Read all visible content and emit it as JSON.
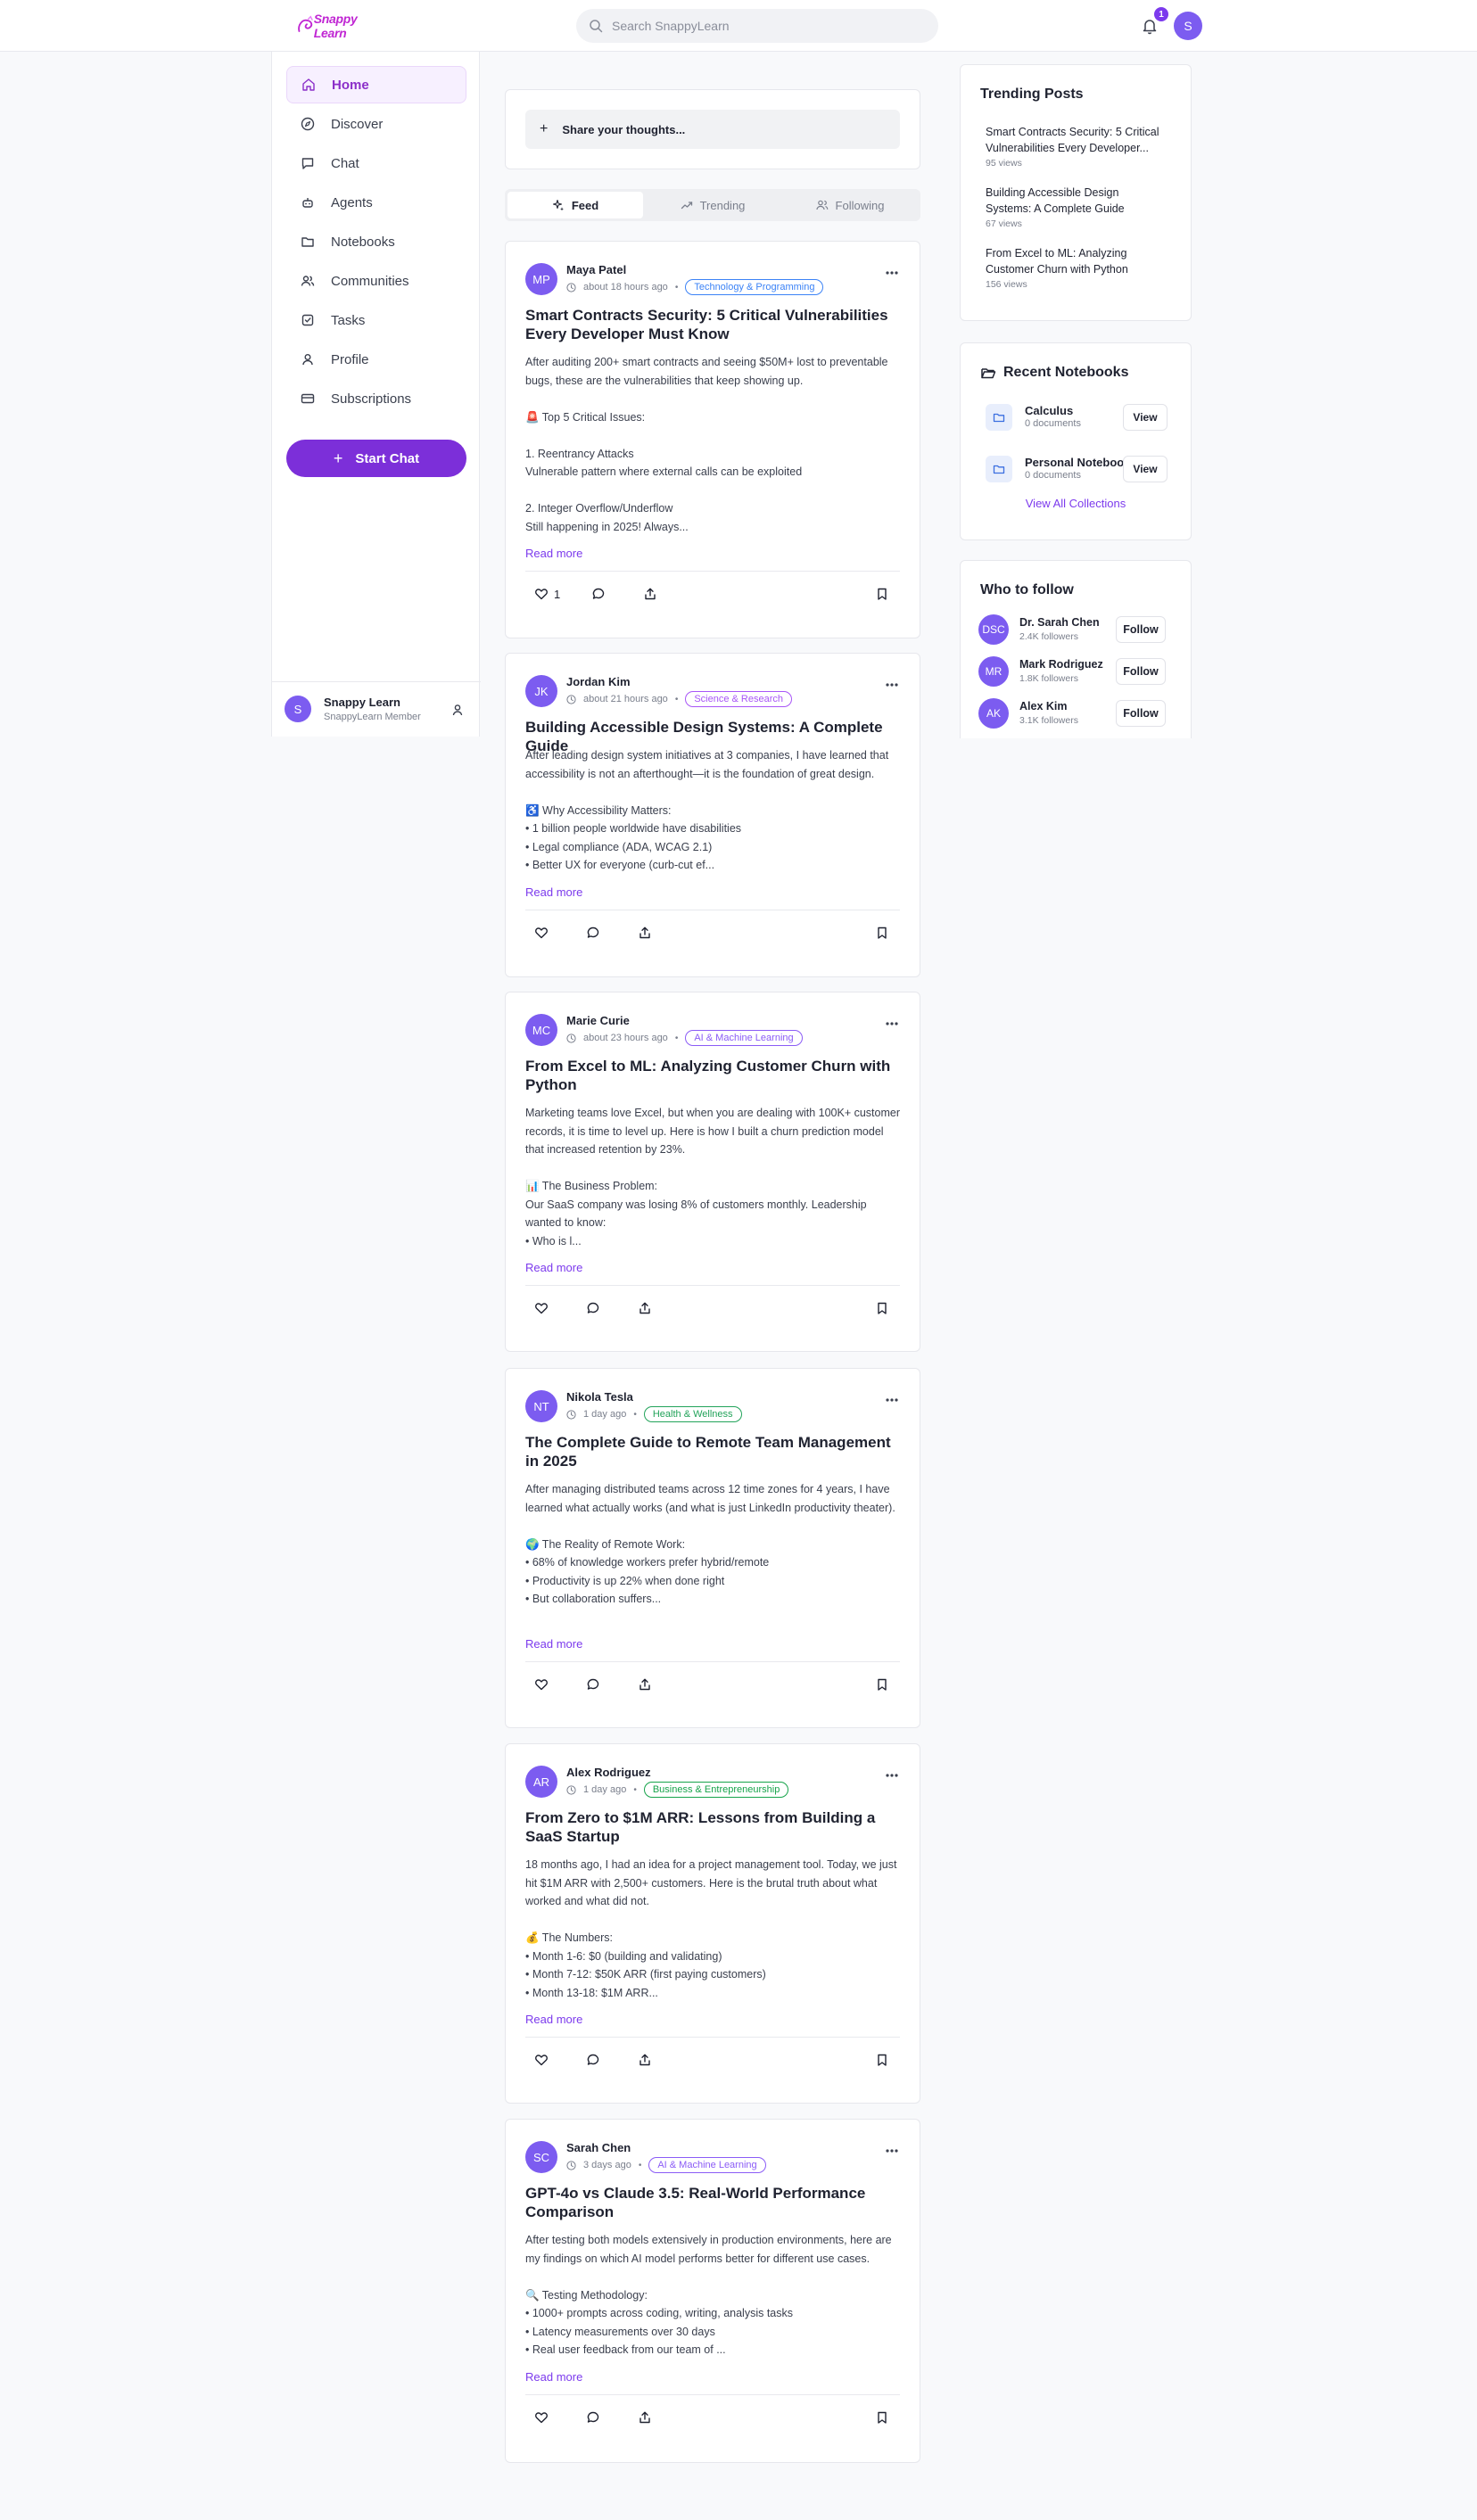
{
  "header": {
    "logo_text": "Snappy Learn",
    "search_placeholder": "Search SnappyLearn",
    "notification_count": "1",
    "user_initial": "S"
  },
  "sidebar": {
    "items": [
      {
        "label": "Home",
        "icon": "home-icon"
      },
      {
        "label": "Discover",
        "icon": "compass-icon"
      },
      {
        "label": "Chat",
        "icon": "chat-icon"
      },
      {
        "label": "Agents",
        "icon": "bot-icon"
      },
      {
        "label": "Notebooks",
        "icon": "folder-icon"
      },
      {
        "label": "Communities",
        "icon": "users-icon"
      },
      {
        "label": "Tasks",
        "icon": "checkbox-icon"
      },
      {
        "label": "Profile",
        "icon": "user-icon"
      },
      {
        "label": "Subscriptions",
        "icon": "credit-card-icon"
      }
    ],
    "start_chat": "Start Chat",
    "user": {
      "initial": "S",
      "name": "Snappy Learn",
      "role": "SnappyLearn Member"
    }
  },
  "composer": {
    "placeholder": "Share your thoughts..."
  },
  "tabs": [
    {
      "label": "Feed"
    },
    {
      "label": "Trending"
    },
    {
      "label": "Following"
    }
  ],
  "posts": [
    {
      "initials": "MP",
      "author": "Maya Patel",
      "time": "about 18 hours ago",
      "tag": "Technology & Programming",
      "tag_color": "#3b82f6",
      "title": "Smart Contracts Security: 5 Critical Vulnerabilities Every Developer Must Know",
      "body": "After auditing 200+ smart contracts and seeing $50M+ lost to preventable bugs, these are the vulnerabilities that keep showing up.\n\n🚨 Top 5 Critical Issues:\n\n1. Reentrancy Attacks\nVulnerable pattern where external calls can be exploited\n\n2. Integer Overflow/Underflow\nStill happening in 2025! Always...",
      "read_more": "Read more",
      "likes": "1"
    },
    {
      "initials": "JK",
      "author": "Jordan Kim",
      "time": "about 21 hours ago",
      "tag": "Science & Research",
      "tag_color": "#a855f7",
      "title": "Building Accessible Design Systems: A Complete Guide",
      "body": "After leading design system initiatives at 3 companies, I have learned that accessibility is not an afterthought—it is the foundation of great design.\n\n♿ Why Accessibility Matters:\n• 1 billion people worldwide have disabilities\n• Legal compliance (ADA, WCAG 2.1)\n• Better UX for everyone (curb-cut ef...",
      "read_more": "Read more",
      "likes": ""
    },
    {
      "initials": "MC",
      "author": "Marie Curie",
      "time": "about 23 hours ago",
      "tag": "AI & Machine Learning",
      "tag_color": "#8b5cf6",
      "title": "From Excel to ML: Analyzing Customer Churn with Python",
      "body": "Marketing teams love Excel, but when you are dealing with 100K+ customer records, it is time to level up. Here is how I built a churn prediction model that increased retention by 23%.\n\n📊 The Business Problem:\nOur SaaS company was losing 8% of customers monthly. Leadership wanted to know:\n• Who is l...",
      "read_more": "Read more",
      "likes": ""
    },
    {
      "initials": "NT",
      "author": "Nikola Tesla",
      "time": "1 day ago",
      "tag": "Health & Wellness",
      "tag_color": "#22a35a",
      "title": "The Complete Guide to Remote Team Management in 2025",
      "body": "After managing distributed teams across 12 time zones for 4 years, I have learned what actually works (and what is just LinkedIn productivity theater).\n\n🌍 The Reality of Remote Work:\n• 68% of knowledge workers prefer hybrid/remote\n• Productivity is up 22% when done right\n• But collaboration suffers...",
      "read_more": "Read more",
      "likes": ""
    },
    {
      "initials": "AR",
      "author": "Alex Rodriguez",
      "time": "1 day ago",
      "tag": "Business & Entrepreneurship",
      "tag_color": "#16a34a",
      "title": "From Zero to $1M ARR: Lessons from Building a SaaS Startup",
      "body": "18 months ago, I had an idea for a project management tool. Today, we just hit $1M ARR with 2,500+ customers. Here is the brutal truth about what worked and what did not.\n\n💰 The Numbers:\n• Month 1-6: $0 (building and validating)\n• Month 7-12: $50K ARR (first paying customers)\n• Month 13-18: $1M ARR...",
      "read_more": "Read more",
      "likes": ""
    },
    {
      "initials": "SC",
      "author": "Sarah Chen",
      "time": "3 days ago",
      "tag": "AI & Machine Learning",
      "tag_color": "#8b5cf6",
      "title": "GPT-4o vs Claude 3.5: Real-World Performance Comparison",
      "body": "After testing both models extensively in production environments, here are my findings on which AI model performs better for different use cases.\n\n🔍 Testing Methodology:\n• 1000+ prompts across coding, writing, analysis tasks\n• Latency measurements over 30 days\n• Real user feedback from our team of ...",
      "read_more": "Read more",
      "likes": ""
    }
  ],
  "trending": {
    "title": "Trending Posts",
    "items": [
      {
        "title": "Smart Contracts Security: 5 Critical Vulnerabilities Every Developer...",
        "views": "95 views"
      },
      {
        "title": "Building Accessible Design Systems: A Complete Guide",
        "views": "67 views"
      },
      {
        "title": "From Excel to ML: Analyzing Customer Churn with Python",
        "views": "156 views"
      }
    ]
  },
  "notebooks": {
    "title": "Recent Notebooks",
    "items": [
      {
        "name": "Calculus",
        "docs": "0 documents",
        "button": "View"
      },
      {
        "name": "Personal Notebook",
        "docs": "0 documents",
        "button": "View"
      }
    ],
    "view_all": "View All Collections"
  },
  "who_to_follow": {
    "title": "Who to follow",
    "items": [
      {
        "initials": "DSC",
        "name": "Dr. Sarah Chen",
        "followers": "2.4K followers",
        "button": "Follow"
      },
      {
        "initials": "MR",
        "name": "Mark Rodriguez",
        "followers": "1.8K followers",
        "button": "Follow"
      },
      {
        "initials": "AK",
        "name": "Alex Kim",
        "followers": "3.1K followers",
        "button": "Follow"
      }
    ]
  },
  "colors": {
    "accent": "#7c3aed",
    "brand": "#c026d3",
    "avatar": "#7c5cf0"
  }
}
